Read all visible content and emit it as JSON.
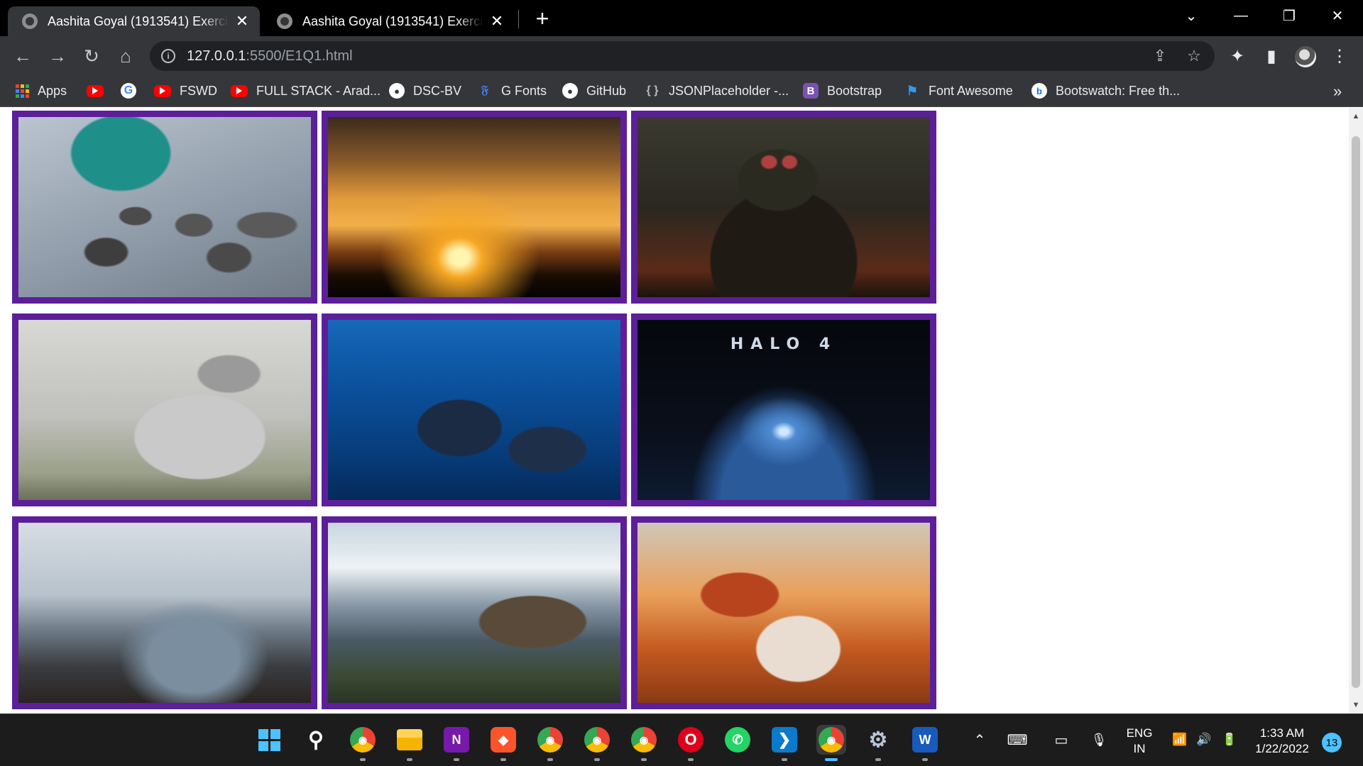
{
  "browser": {
    "tabs": [
      {
        "title": "Aashita Goyal (1913541) Exercise",
        "close": "✕"
      },
      {
        "title": "Aashita Goyal (1913541) Exercise",
        "close": "✕"
      }
    ],
    "new_tab": "+",
    "window_controls": {
      "tab_search": "⌄",
      "minimize": "—",
      "restore": "❐",
      "close": "✕"
    },
    "toolbar": {
      "back": "←",
      "forward": "→",
      "reload": "↻",
      "home": "⌂",
      "url_host": "127.0.0.1",
      "url_rest": ":5500/E1Q1.html",
      "info": "i",
      "share": "⇪",
      "star": "☆",
      "extensions": "✦",
      "sidepanel": "▮",
      "menu": "⋮"
    },
    "bookmarks": [
      {
        "label": "Apps",
        "icon": "apps-grid-icon"
      },
      {
        "label": "",
        "icon": "youtube-icon"
      },
      {
        "label": "",
        "icon": "google-icon",
        "glyph": "G"
      },
      {
        "label": "FSWD",
        "icon": "youtube-icon"
      },
      {
        "label": "FULL STACK - Arad...",
        "icon": "youtube-icon"
      },
      {
        "label": "DSC-BV",
        "icon": "github-icon",
        "glyph": "●"
      },
      {
        "label": "G Fonts",
        "icon": "google-fonts-icon",
        "glyph": "𝔉"
      },
      {
        "label": "GitHub",
        "icon": "github-icon",
        "glyph": "●"
      },
      {
        "label": "JSONPlaceholder -...",
        "icon": "json-icon",
        "glyph": "{ }"
      },
      {
        "label": "Bootstrap",
        "icon": "bootstrap-icon",
        "glyph": "B"
      },
      {
        "label": "Font Awesome",
        "icon": "font-awesome-flag-icon",
        "glyph": "⚑"
      },
      {
        "label": "Bootswatch: Free th...",
        "icon": "bootswatch-icon",
        "glyph": "b"
      }
    ],
    "bookmarks_more": "»"
  },
  "page": {
    "border_color": "#5c1f99",
    "images": [
      {
        "subject": "stones-and-pouch"
      },
      {
        "subject": "sunset-clouds"
      },
      {
        "subject": "armored-soldier"
      },
      {
        "subject": "tabby-cat"
      },
      {
        "subject": "humpback-whales"
      },
      {
        "subject": "halo-4-logo",
        "text": "HALO 4"
      },
      {
        "subject": "city-skyline"
      },
      {
        "subject": "mountain-temple"
      },
      {
        "subject": "desert-skull"
      }
    ]
  },
  "taskbar": {
    "apps": [
      {
        "name": "start",
        "glyph": "⊞"
      },
      {
        "name": "search",
        "glyph": "⚲"
      },
      {
        "name": "chrome-profile-1",
        "glyph": "◉"
      },
      {
        "name": "file-explorer",
        "glyph": "▬"
      },
      {
        "name": "onenote",
        "glyph": "N"
      },
      {
        "name": "brave",
        "glyph": "◆"
      },
      {
        "name": "chrome-profile-2",
        "glyph": "◉"
      },
      {
        "name": "chrome-profile-3",
        "glyph": "◉"
      },
      {
        "name": "chrome-profile-4",
        "glyph": "◉"
      },
      {
        "name": "opera",
        "glyph": "O"
      },
      {
        "name": "whatsapp",
        "glyph": "✆"
      },
      {
        "name": "vscode",
        "glyph": "❯"
      },
      {
        "name": "chrome-active",
        "glyph": "◉"
      },
      {
        "name": "settings",
        "glyph": "⚙"
      },
      {
        "name": "word",
        "glyph": "W"
      }
    ],
    "tray": {
      "chevron": "⌃",
      "keyboard": "⌨",
      "tablet": "▭",
      "mic": "🎙",
      "lang_top": "ENG",
      "lang_bottom": "IN",
      "wifi": "📶",
      "volume": "🔊",
      "battery": "🔋",
      "time": "1:33 AM",
      "date": "1/22/2022",
      "notifications": "13"
    }
  }
}
